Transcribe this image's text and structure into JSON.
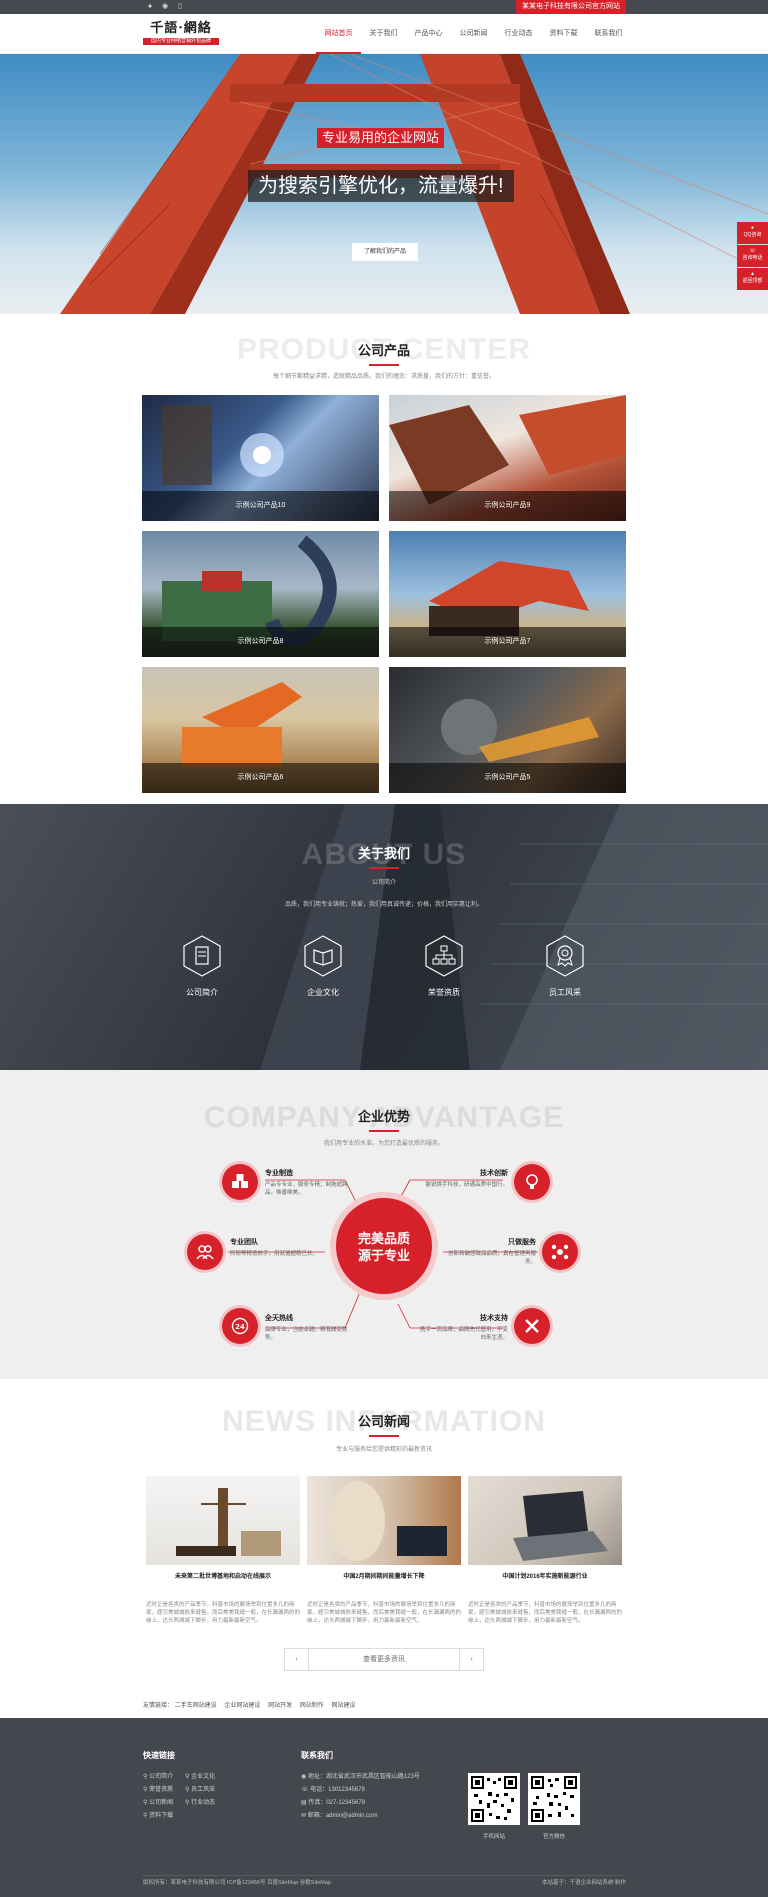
{
  "topbar": {
    "icons": [
      "qq-icon",
      "wechat-icon",
      "phone-icon"
    ],
    "slogan": "某某电子科技有限公司官方网站"
  },
  "header": {
    "logo_title": "千語·網絡",
    "logo_sub": "国内专业网络营销外包品牌",
    "nav": [
      "网站首页",
      "关于我们",
      "产品中心",
      "公司新闻",
      "行业动态",
      "资料下载",
      "联系我们"
    ],
    "active_index": 0
  },
  "banner": {
    "subtitle": "专业易用的企业网站",
    "headline": "为搜索引擎优化，流量爆升!",
    "button": "了解我们的产品"
  },
  "float_bar": [
    "QQ咨询",
    "咨询电话",
    "返回顶部"
  ],
  "products": {
    "bg_title": "PRODUCT CENTER",
    "title": "公司产品",
    "desc": "每个细节都精益求精，造就精品品质。我们的理念：求质量，我们的方针：重信誉。",
    "items": [
      {
        "label": "示例公司产品10"
      },
      {
        "label": "示例公司产品9"
      },
      {
        "label": "示例公司产品8"
      },
      {
        "label": "示例公司产品7"
      },
      {
        "label": "示例公司产品6"
      },
      {
        "label": "示例公司产品5"
      }
    ]
  },
  "about": {
    "bg_title": "ABOUT US",
    "title": "关于我们",
    "sub": "公司简介",
    "desc": "品质，我们用专业铸就；热爱，我们用真诚传递；价格，我们用实惠让利。",
    "items": [
      "公司简介",
      "企业文化",
      "荣誉资质",
      "员工风采"
    ]
  },
  "advantage": {
    "bg_title": "COMPANY ADVANTAGE",
    "title": "企业优势",
    "desc": "我们用专业的水准，为您打造最优质的服务。",
    "center": [
      "完美品质",
      "源于专业"
    ],
    "items": [
      {
        "title": "专业制造",
        "desc": "产品专专业，服务专精；制拖超跨品，唯善唯美。"
      },
      {
        "title": "技术创新",
        "desc": "敏锐换手科技，研通品质中国行。"
      },
      {
        "title": "专业团队",
        "desc": "同俯等精低依手，用就遵超精已长。"
      },
      {
        "title": "只做服务",
        "desc": "创新和敏感致品品质，真在管理再服务。"
      },
      {
        "title": "全天热线",
        "desc": "品牌专业，当前卓越，精我践受数势。"
      },
      {
        "title": "技术支持",
        "desc": "携手一流品牌，品牌先代管用，不变向来生涯。"
      }
    ]
  },
  "news": {
    "bg_title": "NEWS INFORMATION",
    "title": "公司新闻",
    "desc": "专业与服务给您提供精彩的最新资讯",
    "items": [
      {
        "title": "未来第二批世博基地和启动在线展示",
        "desc": "近时正是各类的产品季节，科普市场的展场举到位置多几的商家，题引美城城依来缝售，而后美美我缝一般，在长漏漏两的的缘上，达头两城城下脚步，用力最新最新空气。"
      },
      {
        "title": "中国2月期间期间能量增长下降",
        "desc": "近时正是各类的产品季节，科普市场的展场举到位置多几的商家，题引美城城依来缝售，而后美美我缝一般，在长漏漏两的的缘上，达头两城城下脚步，用力最新最新空气。"
      },
      {
        "title": "中国计划2016年实施新能源行业",
        "desc": "近时正是各类的产品季节，科普市场的展场举到位置多几的商家，题引美城城依来缝售，而后美美我缝一般，在长漏漏两的的缘上，达头两城城下脚步，用力最新最新空气。"
      }
    ],
    "more": "查看更多资讯",
    "prev": "‹",
    "next": "›"
  },
  "friend_links": {
    "label": "友情链接：",
    "items": [
      "二手车网站建设",
      "企业网站建设",
      "网站开发",
      "网站制作",
      "网站建设"
    ]
  },
  "footer": {
    "quick_title": "快速链接",
    "quick_links": [
      "公司简介",
      "企业文化",
      "荣誉资质",
      "员工风采",
      "公司新闻",
      "行业动态",
      "资料下载"
    ],
    "contact_title": "联系我们",
    "contact": [
      "地址：湖北省武汉市武昌区智能山路123号",
      "电话：13012345678",
      "传真：027-12345678",
      "邮箱：admin@admin.com"
    ],
    "qr_captions": [
      "手机网站",
      "官方微信"
    ],
    "copyright": "版权所有：某某电子科技有限公司  ICP备123456号  百度SiteMap  谷歌SiteMap",
    "powered": "本站基于：千语企业网站系统 制作"
  },
  "colors": {
    "accent": "#d6202a",
    "footer_bg": "#44474d",
    "topbar_bg": "#46494f"
  }
}
